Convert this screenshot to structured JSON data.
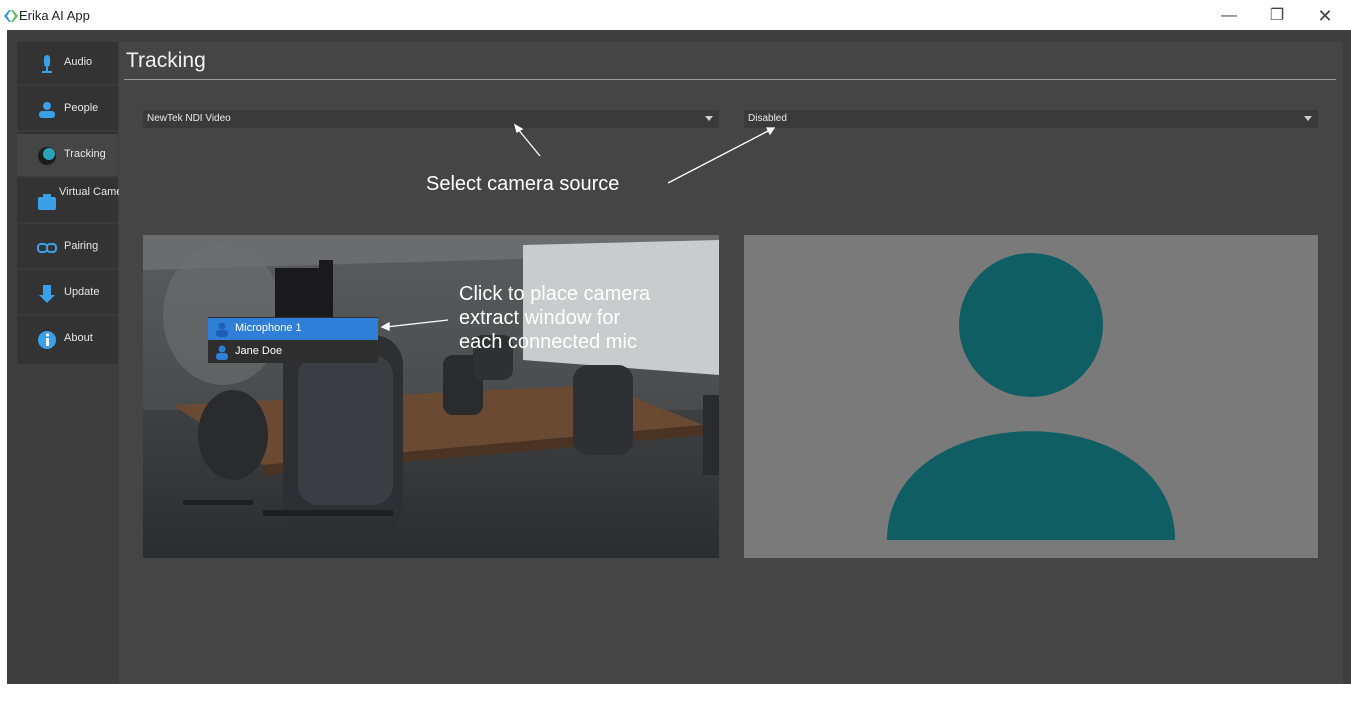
{
  "window": {
    "title": "Erika AI App",
    "minimize_icon": "minimize-icon",
    "restore_icon": "restore-icon",
    "close_icon": "close-icon",
    "minimize_glyph": "—",
    "restore_glyph": "❐",
    "close_glyph": "✕"
  },
  "sidebar": {
    "items": [
      {
        "label": "Audio",
        "icon": "microphone-icon",
        "active": false
      },
      {
        "label": "People",
        "icon": "people-icon",
        "active": false
      },
      {
        "label": "Tracking",
        "icon": "tracking-icon",
        "active": true
      },
      {
        "label": "Virtual Camera",
        "icon": "camera-icon",
        "active": false
      },
      {
        "label": "Pairing",
        "icon": "link-icon",
        "active": false
      },
      {
        "label": "Update",
        "icon": "update-icon",
        "active": false
      },
      {
        "label": "About",
        "icon": "info-icon",
        "active": false
      }
    ]
  },
  "main": {
    "title": "Tracking",
    "camera_source_select": {
      "value": "NewTek NDI Video"
    },
    "second_select": {
      "value": "Disabled"
    },
    "annotation_select": "Select camera source",
    "annotation_click": "Click to place camera extract window for each connected mic",
    "annotation_click_lines": [
      "Click to place camera",
      "extract window for",
      "each connected mic"
    ],
    "mic_menu": [
      {
        "label": "Microphone 1",
        "selected": true
      },
      {
        "label": "Jane Doe",
        "selected": false
      }
    ]
  },
  "colors": {
    "accent": "#2f7ed8",
    "icon_blue": "#3aa0e8",
    "placeholder_teal": "#0e5e64",
    "panel_bg": "#454545"
  }
}
